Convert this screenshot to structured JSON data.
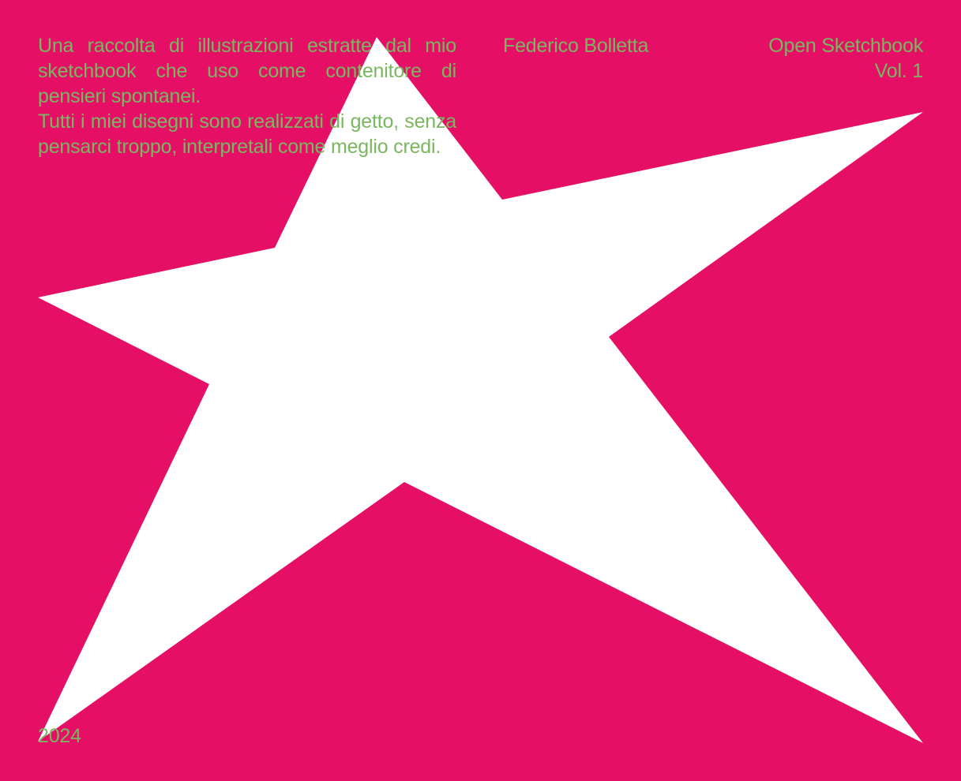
{
  "cover": {
    "background_color": "#e50f66",
    "text_color": "#7bb661",
    "star_color": "#ffffff",
    "intro_paragraph_1": "Una raccolta di illustrazioni estratte dal mio sketchbook che uso come contenitore di pensieri spontanei.",
    "intro_paragraph_2": "Tutti i miei disegni sono realizzati di getto, senza pensarci troppo, interpretali come meglio credi.",
    "author": "Federico Bolletta",
    "title_line_1": "Open Sketchbook",
    "title_line_2": "Vol. 1",
    "year": "2024"
  }
}
